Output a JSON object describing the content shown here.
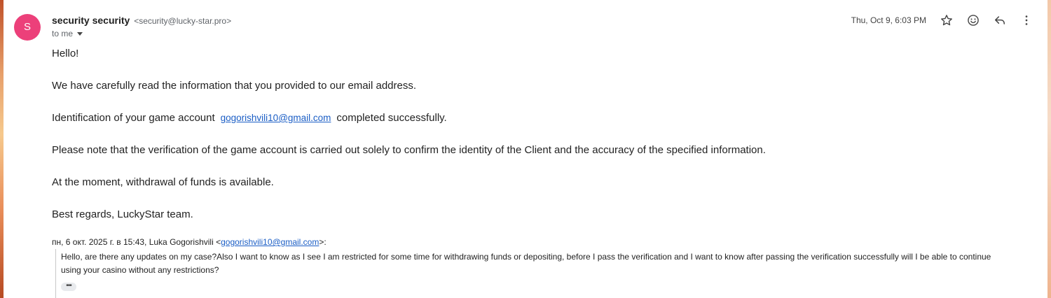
{
  "sender": {
    "avatar_letter": "S",
    "avatar_color": "#ec407a",
    "name": "security security",
    "email": "<security@lucky-star.pro>",
    "to": "to me"
  },
  "header": {
    "date": "Thu, Oct 9, 6:03 PM",
    "icons": [
      "star-icon",
      "emoji-icon",
      "reply-icon",
      "more-vert-icon"
    ]
  },
  "body": {
    "greeting": "Hello!",
    "line1": "We have carefully read the information that you provided to our email address.",
    "line2_pre": "Identification of your game account",
    "line2_email": "gogorishvili10@gmail.com",
    "line2_post": "completed successfully.",
    "line3": "Please note that the verification of the game account is carried out solely to confirm the identity of the Client and the accuracy of the specified information.",
    "line4": "At the moment, withdrawal of funds is available.",
    "signoff": "Best regards, LuckyStar team."
  },
  "quote": {
    "header_pre": "пн, 6 окт. 2025 г. в 15:43, Luka Gogorishvili <",
    "header_email": "gogorishvili10@gmail.com",
    "header_post": ">:",
    "text": "Hello, are there any updates on my case?Also I want to know as I see I am restricted for some time for withdrawing funds or depositing, before I pass the verification and I want to know after passing the verification successfully will I be able to continue using your casino without any restrictions?",
    "more_label": "•••"
  },
  "colors": {
    "link": "#1a5dc5",
    "secondary_text": "#5f6368"
  }
}
